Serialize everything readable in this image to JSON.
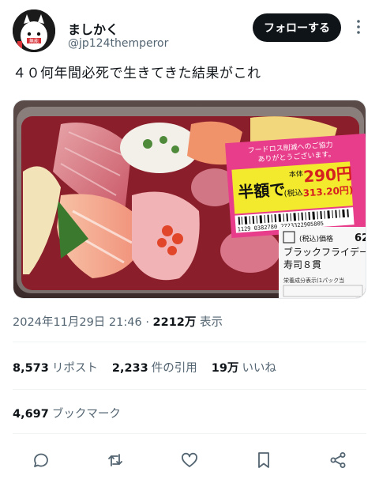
{
  "user": {
    "display_name": "ましかく",
    "handle": "@jp124themperor",
    "avatar_text": "無能"
  },
  "follow_label": "フォローする",
  "tweet_text": "４０何年間必死で生きてきた結果がこれ",
  "media": {
    "icon": "sushi-pack-photo",
    "sticker": {
      "top_note": "フードロス削減へのご協力",
      "top_note2": "ありがとうございます。",
      "half_price": "半額で",
      "base_label": "本体",
      "price": "290円",
      "tax_label": "(税込",
      "tax_price": "313.20円)",
      "barcode_number": "1129 0382780 2723322905805"
    },
    "label": {
      "tax_incl": "(税込)価格",
      "price_partial": "62",
      "product_line1": "ブラックフライデー",
      "product_line2": "寿司８貫",
      "nutrition": "栄養成分表示(1パック当"
    }
  },
  "meta": {
    "datetime": "2024年11月29日 21:46",
    "separator": "·",
    "views_count": "2212万",
    "views_label": "表示"
  },
  "stats": {
    "reposts_count": "8,573",
    "reposts_label": "リポスト",
    "quotes_count": "2,233",
    "quotes_label": "件の引用",
    "likes_count": "19万",
    "likes_label": "いいね",
    "bookmarks_count": "4,697",
    "bookmarks_label": "ブックマーク"
  },
  "actions": [
    "reply-icon",
    "repost-icon",
    "like-icon",
    "bookmark-icon",
    "share-icon"
  ],
  "colors": {
    "text": "#0f1419",
    "secondary": "#536471",
    "divider": "#eff3f4",
    "button_bg": "#0f1419",
    "sticker_yellow": "#f3ea2d",
    "sticker_pink": "#e83d8a"
  }
}
